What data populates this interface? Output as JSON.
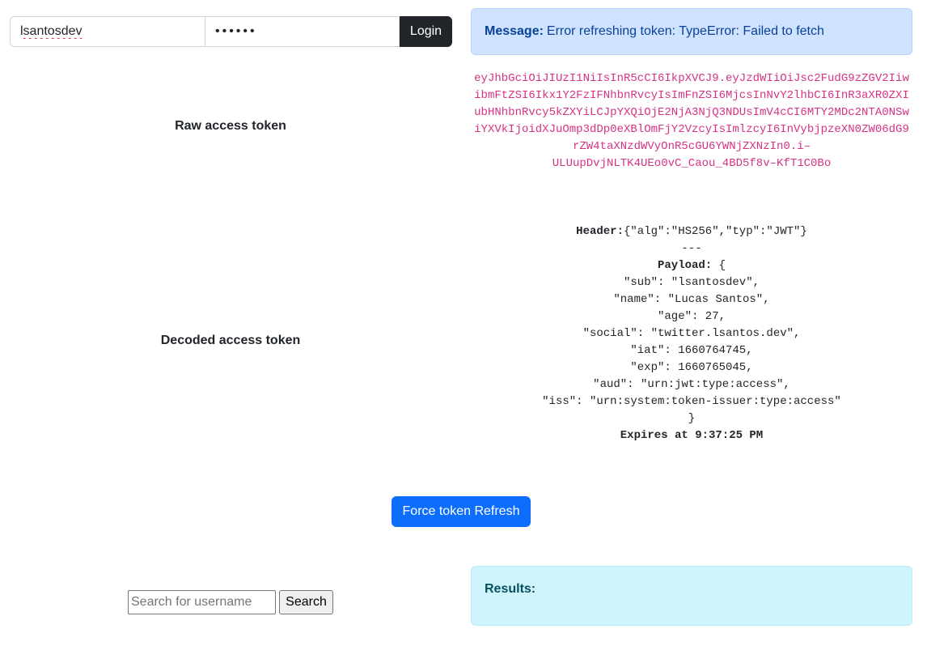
{
  "login": {
    "username_value": "lsantosdev",
    "password_value": "••••••",
    "login_label": "Login"
  },
  "message": {
    "prefix": "Message:",
    "text": "Error refreshing token: TypeError: Failed to fetch"
  },
  "raw_token": {
    "label": "Raw access token",
    "lines": [
      "eyJhbGciOiJIUzI1NiIsInR5cCI6IkpXVCJ9.eyJzdWIiOiJsc2FudG9zZGV2Iiw",
      "ibmFtZSI6Ikx1Y2FzIFNhbnRvcyIsImFnZSI6MjcsInNvY2lhbCI6InR3aXR0ZXI",
      "ubHNhbnRvcy5kZXYiLCJpYXQiOjE2NjA3NjQ3NDUsImV4cCI6MTY2MDc2NTA0NSw",
      "iYXVkIjoidXJuOmp3dDp0eXBlOmFjY2VzcyIsImlzcyI6InVybjpzeXN0ZW06dG9",
      "rZW4taXNzdWVyOnR5cGU6YWNjZXNzIn0.i–",
      "ULUupDvjNLTK4UEo0vC_Caou_4BD5f8v–KfT1C0Bo"
    ]
  },
  "decoded_token": {
    "label": "Decoded access token",
    "header_label": "Header:",
    "header_value": "{\"alg\":\"HS256\",\"typ\":\"JWT\"}",
    "separator": "---",
    "payload_label": "Payload:",
    "payload_open": " {",
    "payload_lines": [
      "\"sub\": \"lsantosdev\",",
      "\"name\": \"Lucas Santos\",",
      "\"age\": 27,",
      "\"social\": \"twitter.lsantos.dev\",",
      "\"iat\": 1660764745,",
      "\"exp\": 1660765045,",
      "\"aud\": \"urn:jwt:type:access\",",
      "\"iss\": \"urn:system:token-issuer:type:access\""
    ],
    "payload_close": "}",
    "expires": "Expires at 9:37:25 PM"
  },
  "force_refresh_label": "Force token Refresh",
  "search": {
    "placeholder": "Search for username",
    "button_label": "Search"
  },
  "results": {
    "label": "Results:"
  }
}
